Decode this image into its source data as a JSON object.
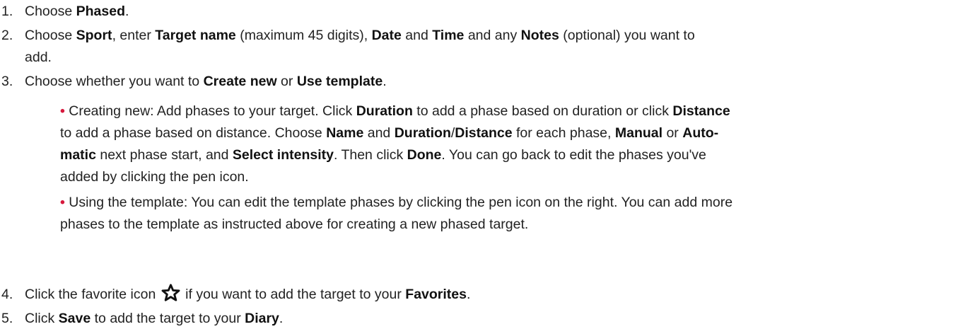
{
  "steps": [
    {
      "num": "1.",
      "pre": "Choose ",
      "b1": "Phased",
      "post": "."
    },
    {
      "num": "2.",
      "t1": "Choose ",
      "b1": "Sport",
      "t2": ", enter ",
      "b2": "Target name",
      "t3": " (maximum 45 digits), ",
      "b3": "Date",
      "t4": " and ",
      "b4": "Time",
      "t5": " and any ",
      "b5": "Notes",
      "t6": " (optional) you want to",
      "t7": "add."
    },
    {
      "num": "3.",
      "t1": "Choose whether you want to ",
      "b1": "Create new",
      "t2": " or ",
      "b2": "Use template",
      "t3": "."
    },
    {
      "num": "4.",
      "t1": "Click the favorite icon ",
      "t2": " if you want to add the target to your ",
      "b1": "Favorites",
      "t3": "."
    },
    {
      "num": "5.",
      "t1": "Click ",
      "b1": "Save",
      "t2": " to add the target to your ",
      "b2": "Diary",
      "t3": "."
    }
  ],
  "bullets": {
    "creating": {
      "t1": "Creating new: Add phases to your target. Click ",
      "b1": "Duration",
      "t2": " to add a phase based on duration or click ",
      "b2": "Distance",
      "t3": "to add a phase based on distance. Choose ",
      "b3": "Name",
      "t4": " and ",
      "b4": "Duration",
      "t5": "/",
      "b5": "Distance",
      "t6": " for each phase, ",
      "b6": "Manual",
      "t7": " or ",
      "b7": "Auto-",
      "b8": "matic",
      "t8": " next phase start, and ",
      "b9": "Select intensity",
      "t9": ". Then click ",
      "b10": "Done",
      "t10": ". You can go back to edit the phases you've",
      "t11": "added by clicking the pen icon."
    },
    "template": {
      "t1": "Using the template: You can edit the template phases by clicking the pen icon on the right. You can add more",
      "t2": "phases to the template as instructed above for creating a new phased target."
    }
  },
  "bullet_glyph": "•",
  "colors": {
    "bullet": "#d7193d",
    "text": "#222222"
  },
  "icons": {
    "favorite": "star-outline-icon"
  }
}
